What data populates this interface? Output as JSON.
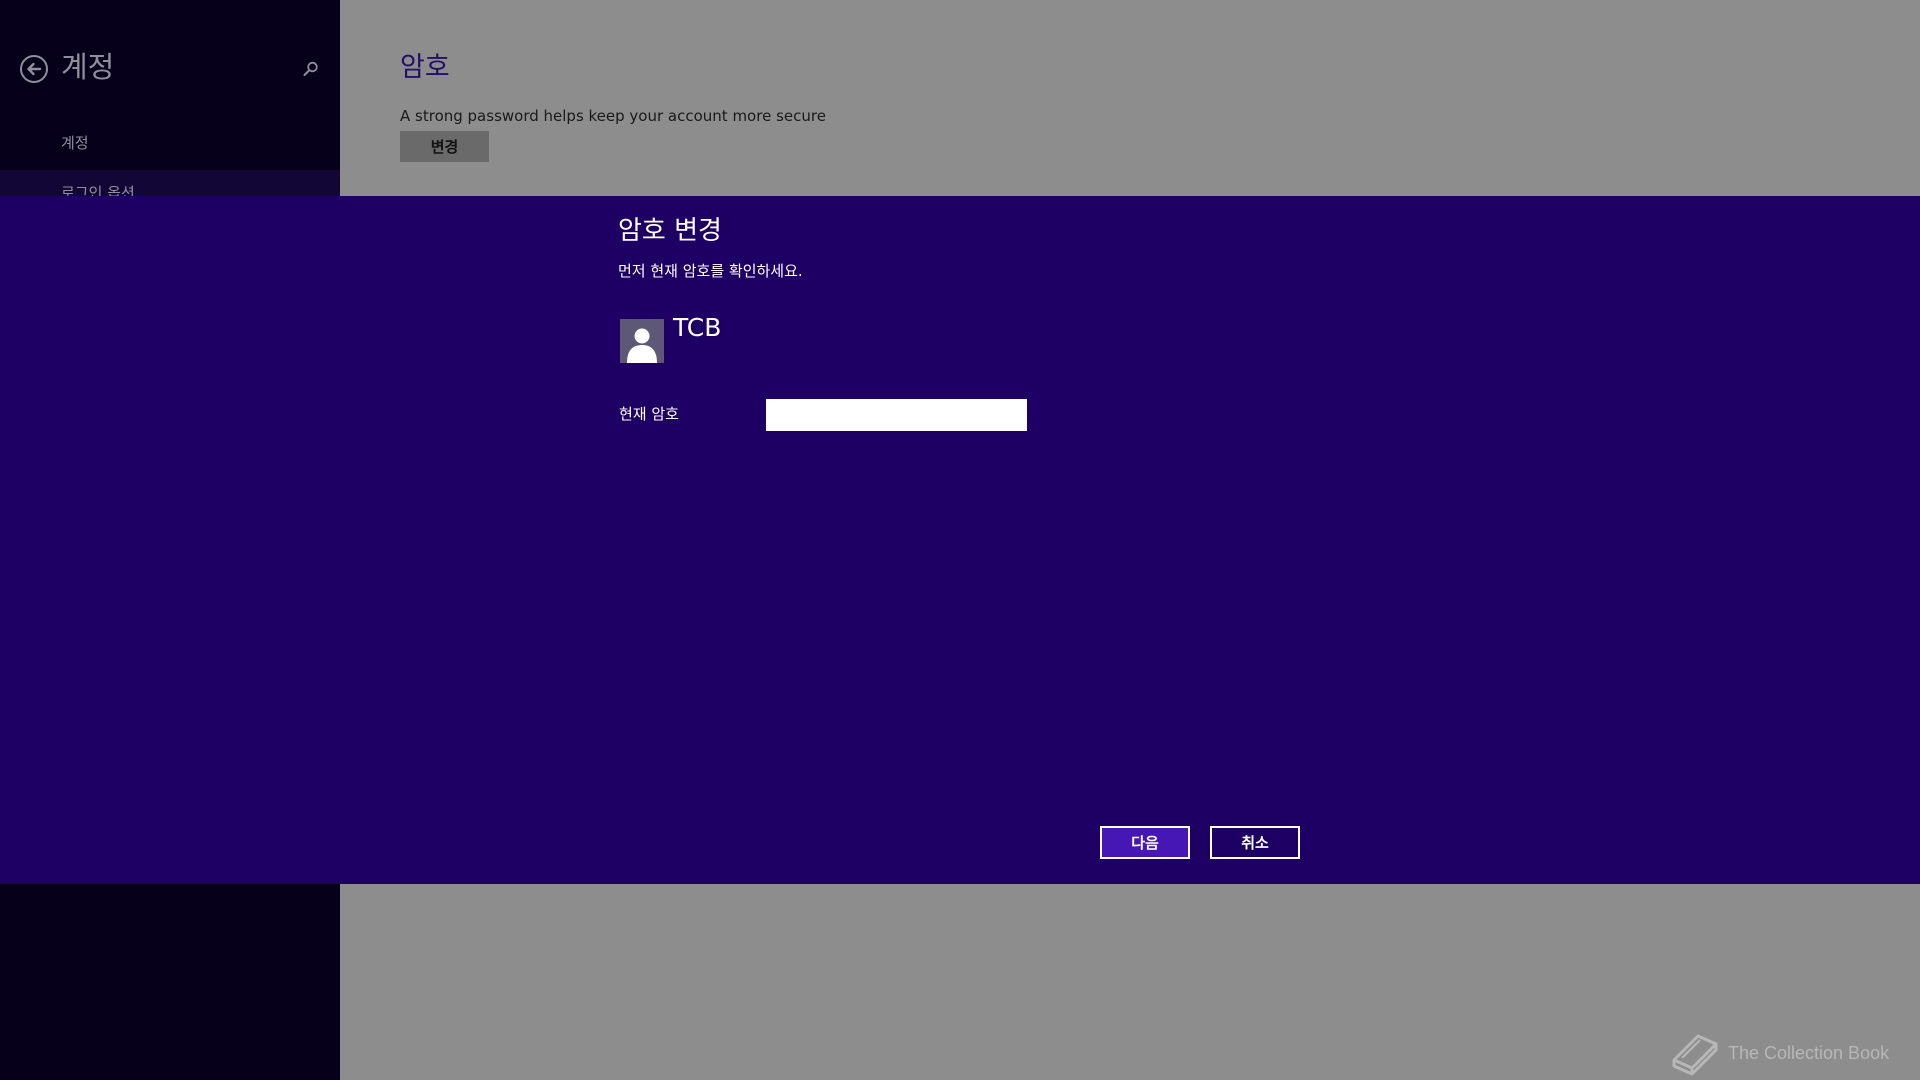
{
  "sidebar": {
    "title": "계정",
    "back_icon": "back-arrow-icon",
    "search_icon": "search-icon",
    "items": [
      {
        "label": "계정"
      },
      {
        "label": "로그인 옵션"
      }
    ]
  },
  "main": {
    "section_title": "암호",
    "description": "A strong password helps keep your account more secure",
    "change_button": "변경"
  },
  "dialog": {
    "title": "암호 변경",
    "subtitle": "먼저 현재 암호를 확인하세요.",
    "user": {
      "name": "TCB",
      "avatar_icon": "user-avatar-icon"
    },
    "current_password_label": "현재 암호",
    "current_password_value": "",
    "next_button": "다음",
    "cancel_button": "취소"
  },
  "watermark": {
    "text": "The Collection Book",
    "icon": "book-icon"
  },
  "colors": {
    "dialog_bg": "#1e0064",
    "accent_button": "#4617b4",
    "sidebar_bg": "#07001a",
    "main_bg": "#8d8d8d"
  }
}
